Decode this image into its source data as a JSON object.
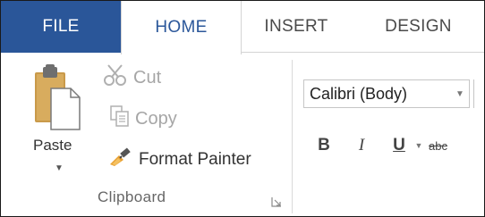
{
  "tabs": {
    "file": "FILE",
    "home": "HOME",
    "insert": "INSERT",
    "design": "DESIGN"
  },
  "clipboard": {
    "paste_label": "Paste",
    "cut_label": "Cut",
    "copy_label": "Copy",
    "format_painter_label": "Format Painter",
    "group_label": "Clipboard",
    "icons": {
      "paste": "paste-clipboard-icon",
      "cut": "scissors-icon",
      "copy": "copy-icon",
      "format_painter": "paintbrush-icon",
      "launcher": "dialog-launcher-icon"
    }
  },
  "font": {
    "font_name": "Calibri (Body)",
    "bold": "B",
    "italic": "I",
    "underline": "U",
    "strikethrough": "abc"
  },
  "colors": {
    "file_tab_bg": "#2a5699",
    "home_tab_text": "#2b579a",
    "disabled_text": "#a6a6a6"
  }
}
